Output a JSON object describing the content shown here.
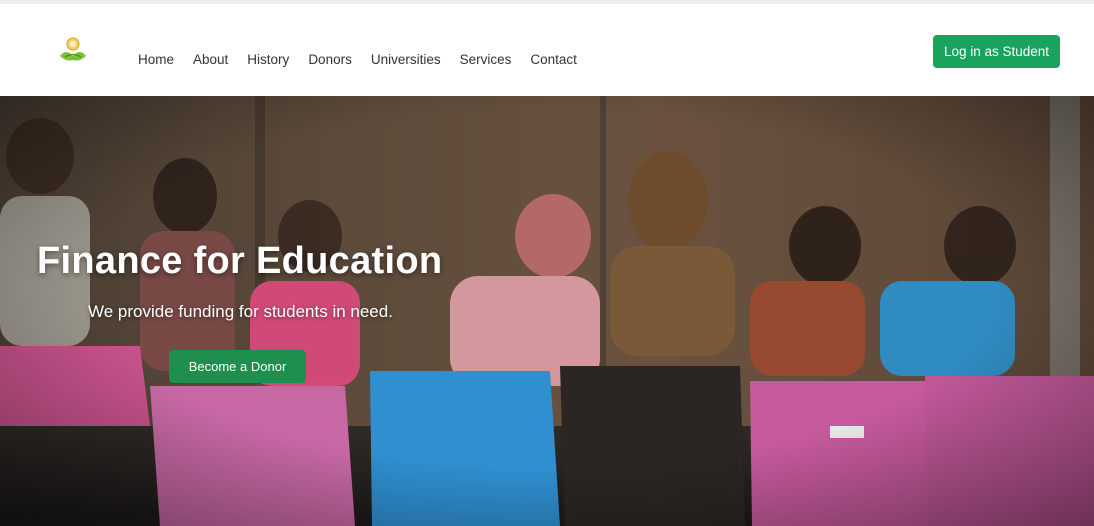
{
  "header": {
    "logo_icon": "lotus-book-logo",
    "nav_items": [
      "Home",
      "About",
      "History",
      "Donors",
      "Universities",
      "Services",
      "Contact"
    ],
    "login_label": "Log in as Student"
  },
  "hero": {
    "title": "Finance for Education",
    "subtitle": "We provide funding for students in need.",
    "cta_label": "Become a Donor",
    "image_icon": "children-classroom-photo"
  },
  "colors": {
    "login_button": "#1aa35c",
    "donor_button": "#1e8f4f",
    "nav_text": "#333333"
  }
}
